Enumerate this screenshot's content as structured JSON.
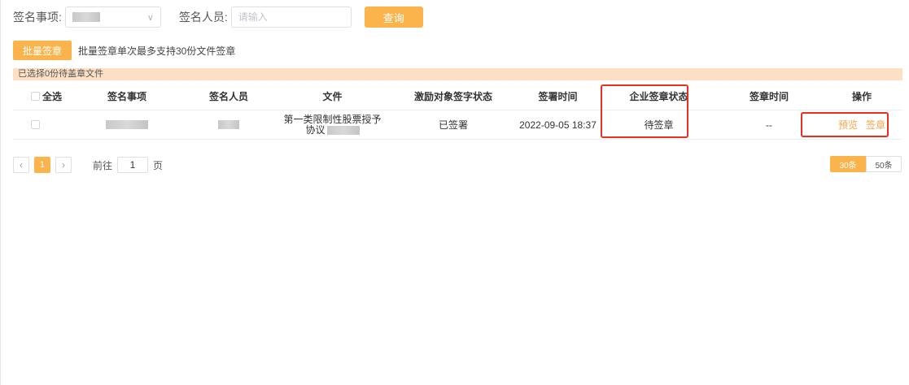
{
  "search": {
    "matter_label": "签名事项:",
    "person_label": "签名人员:",
    "person_placeholder": "请输入",
    "query_label": "查询"
  },
  "batch": {
    "button_label": "批量签章",
    "note": "批量签章单次最多支持30份文件签章"
  },
  "selection": {
    "banner": "已选择0份待盖章文件"
  },
  "table": {
    "headers": {
      "select_all": "全选",
      "matter": "签名事项",
      "person": "签名人员",
      "file": "文件",
      "incentive_status": "激励对象签字状态",
      "sign_time": "签署时间",
      "company_status": "企业签章状态",
      "stamp_time": "签章时间",
      "actions": "操作"
    },
    "rows": [
      {
        "file_line1": "第一类限制性股票授予",
        "file_line2": "协议",
        "incentive_status": "已签署",
        "sign_time": "2022-09-05 18:37",
        "company_status": "待签章",
        "stamp_time": "--",
        "action_preview": "预览",
        "action_sign": "签章"
      }
    ]
  },
  "pagination": {
    "current_page": "1",
    "goto_label": "前往",
    "goto_value": "1",
    "page_unit": "页",
    "size_30": "30条",
    "size_50": "50条"
  },
  "colors": {
    "accent": "#fbb44b",
    "banner": "#fde0c3",
    "highlight": "#e8301c",
    "link": "#f7a44a"
  }
}
